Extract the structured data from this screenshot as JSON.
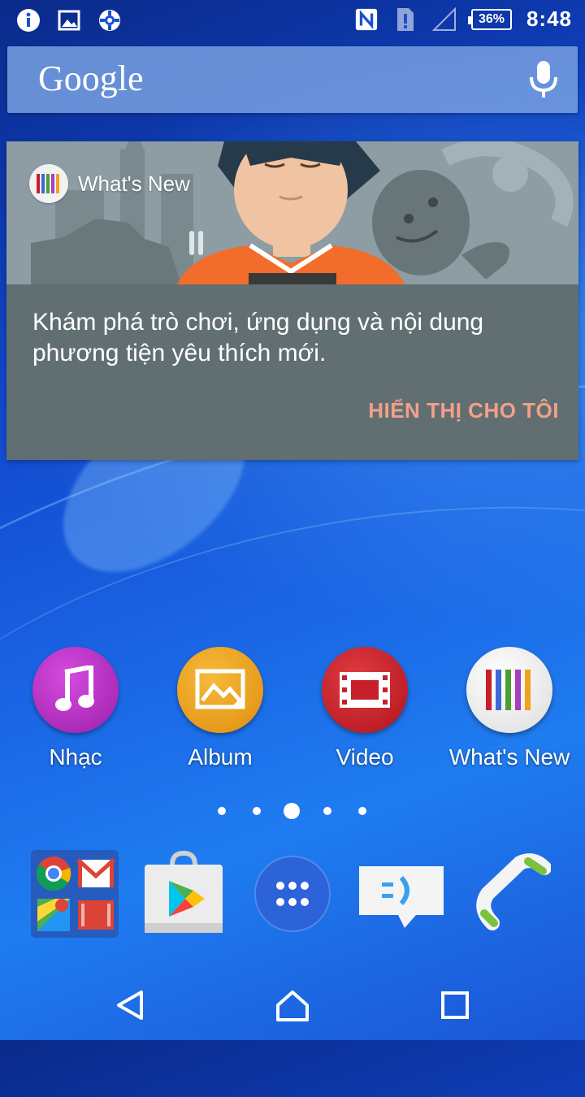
{
  "status_bar": {
    "left_icons": [
      "info-icon",
      "image-icon",
      "support-icon"
    ],
    "right_icons": [
      "nfc-icon",
      "sim-alert-icon",
      "signal-icon"
    ],
    "battery_percent": "36%",
    "time": "8:48"
  },
  "search_bar": {
    "logo_text": "Google",
    "mic_icon": "microphone-icon"
  },
  "card": {
    "badge_title": "What's New",
    "body_text": "Khám phá trò chơi, ứng dụng và nội dung phương tiện yêu thích mới.",
    "action_label": "HIỂN THỊ CHO TÔI",
    "action_color": "#f2a088"
  },
  "apps": [
    {
      "label": "Nhạc",
      "icon": "music-note-icon",
      "color": "#b42fbd"
    },
    {
      "label": "Album",
      "icon": "photo-album-icon",
      "color": "#f0a21c"
    },
    {
      "label": "Video",
      "icon": "film-strip-icon",
      "color": "#c8202a"
    },
    {
      "label": "What's New",
      "icon": "whats-new-icon",
      "color": "#f2f2f2"
    }
  ],
  "page_indicator": {
    "count": 5,
    "active_index": 2
  },
  "dock": [
    "google-apps-folder",
    "play-store-icon",
    "app-drawer-icon",
    "messaging-icon",
    "phone-icon"
  ],
  "nav_bar": [
    "back-icon",
    "home-icon",
    "recents-icon"
  ]
}
